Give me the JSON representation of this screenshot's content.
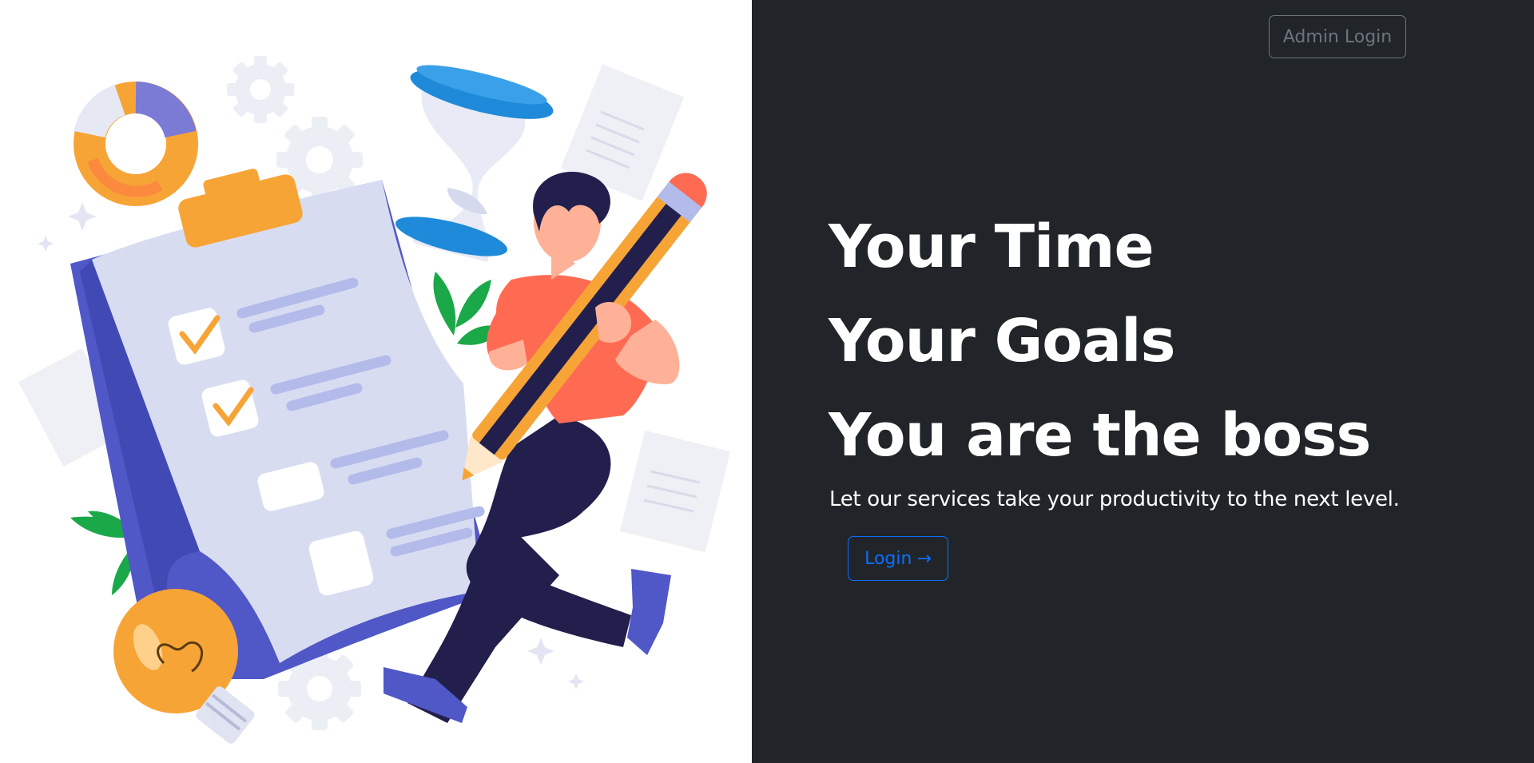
{
  "nav": {
    "admin_login_label": "Admin Login"
  },
  "hero": {
    "line1": "Your Time",
    "line2": "Your Goals",
    "line3": "You are the boss",
    "tagline": "Let our services take your productivity to the next level.",
    "login_label": "Login",
    "login_arrow": "→"
  },
  "colors": {
    "dark_background": "#212529",
    "primary_blue": "#0d6efd",
    "secondary_gray": "#6c757d",
    "text_white": "#ffffff"
  },
  "illustration": {
    "icons": [
      "clipboard-checklist-icon",
      "hourglass-icon",
      "pencil-icon",
      "lightbulb-icon",
      "donut-chart-icon",
      "gear-icon",
      "leaf-icon",
      "document-icon",
      "sparkle-icon"
    ]
  }
}
